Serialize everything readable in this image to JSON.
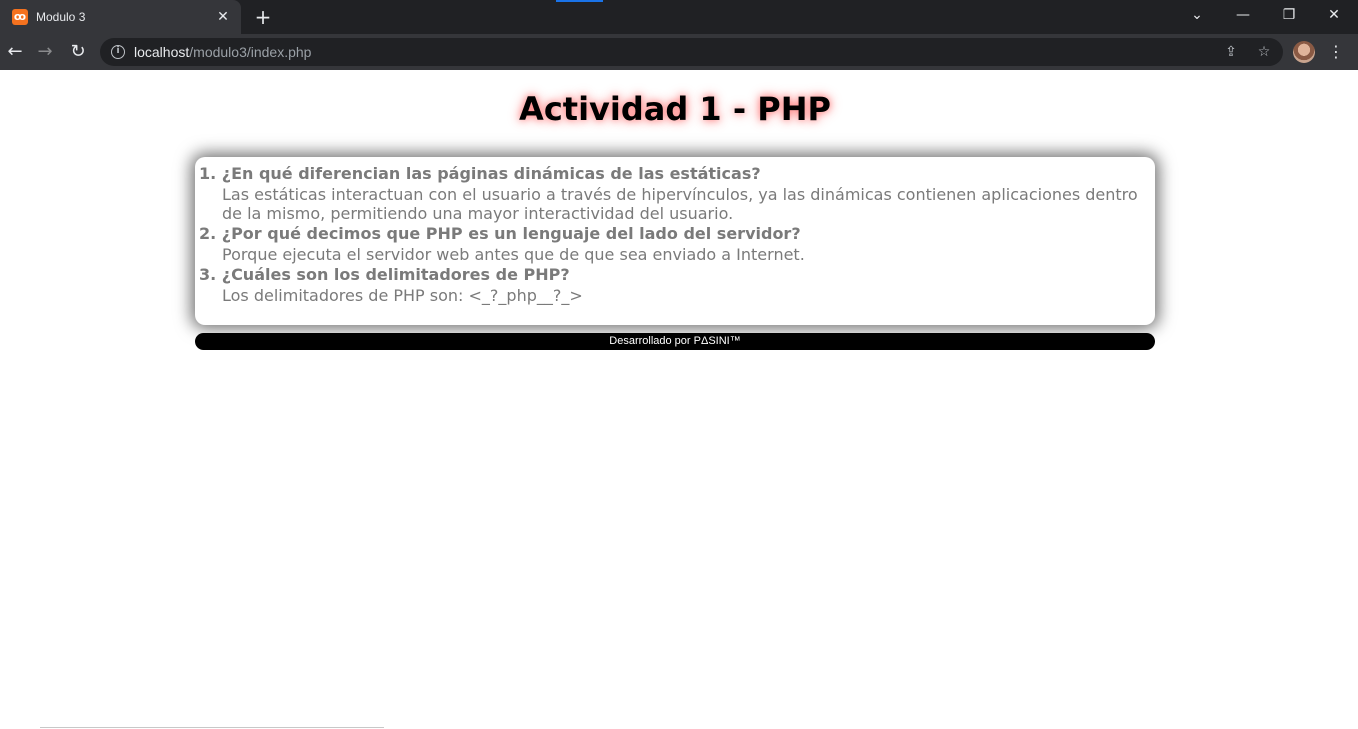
{
  "browser": {
    "tab_title": "Modulo 3",
    "tab_favicon_text": "ꝏ",
    "url_host": "localhost",
    "url_path": "/modulo3/index.php"
  },
  "page": {
    "title": "Actividad 1 - PHP",
    "qa": [
      {
        "question": "1. ¿En qué diferencian las páginas dinámicas de las estáticas?",
        "answer": "Las estáticas interactuan con el usuario a través de hipervínculos, ya las dinámicas contienen aplicaciones dentro de la mismo, permitiendo una mayor interactividad del usuario."
      },
      {
        "question": "2. ¿Por qué decimos que PHP es un lenguaje del lado del servidor?",
        "answer": "Porque ejecuta el servidor web antes que de que sea enviado a Internet."
      },
      {
        "question": "3. ¿Cuáles son los delimitadores de PHP?",
        "answer": "Los delimitadores de PHP son: <_?_php__?_>"
      }
    ],
    "footer": "Desarrollado por PΔSINI™"
  }
}
